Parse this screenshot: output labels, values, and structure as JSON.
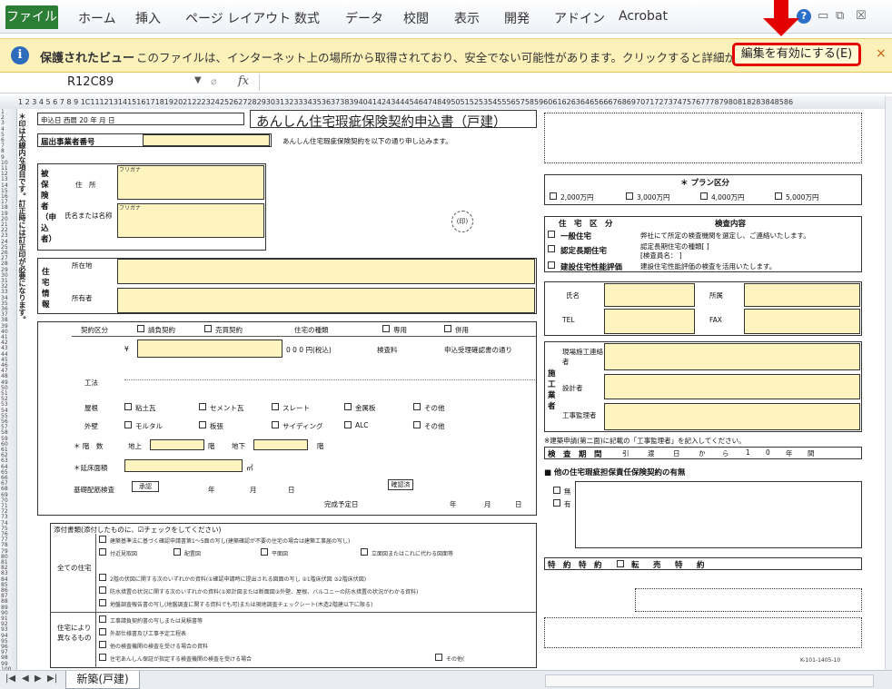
{
  "ribbon": {
    "file": "ファイル",
    "tabs": [
      "ホーム",
      "挿入",
      "ページ レイアウト",
      "数式",
      "データ",
      "校閲",
      "表示",
      "開発",
      "アドイン",
      "Acrobat"
    ]
  },
  "protected_view": {
    "title": "保護されたビュー",
    "message": "このファイルは、インターネット上の場所から取得されており、安全でない可能性があります。クリックすると詳細が表示されます。",
    "enable_button": "編集を有効にする(E)",
    "close": "×"
  },
  "formula_bar": {
    "name_box": "R12C89",
    "fx": "fx",
    "value": ""
  },
  "columns_text": "1 2 3 4 5 6 7 8 9 1C11121314151617181920212223242526272829303132333435363738394041424344454647484950515253545556575859606162636465666768697071727374757677787980818283848586",
  "form": {
    "title": "あんしん住宅瑕疵保険契約申込書（戸建）",
    "apply_date": "申込日 西暦  20    年    月    日",
    "left_side": "＊印は太線内な項目です。訂正時には訂正印が必要になります。",
    "office_no": "届出事業者番号",
    "agree": "あんしん住宅瑕疵保険契約を以下の通り申し込みます。",
    "applicant": "被保険者（申込者）",
    "furigana": "フリガナ",
    "address": "住　所",
    "name_label": "氏名または名称",
    "seal": "(印)",
    "house_info": "住宅情報",
    "location": "所在地",
    "owner": "所有者",
    "plan_title": "＊ プラン区分",
    "plans": [
      "2,000万円",
      "3,000万円",
      "4,000万円",
      "5,000万円"
    ],
    "house_type_title": "住　宅　区　分",
    "inspection": "検査内容",
    "house_types": [
      "一般住宅",
      "認定長期住宅",
      "建設住宅性能評価"
    ],
    "inspect_msgs": [
      "弊社にて所定の検査機関を選定し、ご連絡いたします。",
      "認定長期住宅の種類[                    ]",
      "[検査員名：                          ]",
      "建設住宅性能評価の検査を活用いたします。"
    ],
    "contact": [
      "氏名",
      "所属",
      "TEL",
      "FAX"
    ],
    "builder": "施工業者",
    "builder_rows": [
      "現場施工連絡者",
      "設計者",
      "工事監理者"
    ],
    "contract": "契約区分",
    "contract_opts": [
      "請負契約",
      "売買契約"
    ],
    "house_kind": "住宅の種類",
    "house_kind_opts": [
      "専用",
      "併用"
    ],
    "amount": "¥",
    "amount_unit": "0   0   0  円(税込)",
    "premium": "検査料",
    "premium_note": "申込受理確認書の通り",
    "structure": "構造",
    "construction": "工法",
    "wall": "外壁",
    "roof": "屋根",
    "wall_opts": [
      "モルタル",
      "板張",
      "サイディング",
      "ALC",
      "その他"
    ],
    "roof_opts": [
      "粘土瓦",
      "セメント瓦",
      "スレート",
      "金属板",
      "その他"
    ],
    "floors": "＊ 階　数",
    "above": "地上",
    "below": "地下",
    "floor_unit": "階",
    "area": "＊延床面積",
    "area_unit": "㎡",
    "start_date": "基礎配筋検査",
    "year": "年",
    "month": "月",
    "day": "日",
    "complete": "完成予定日",
    "approval": "承認",
    "approval2": "確認済",
    "permit_note": "※建築申請(第二面)に記載の「工事監理者」を記入してください。",
    "delivery": "検　査　期　間",
    "delivery_vals": [
      "引",
      "渡",
      "日",
      "か",
      "ら",
      "1",
      "0",
      "年",
      "間"
    ],
    "other_title": "■ 他の住宅瑕疵担保責任保険契約の有無",
    "yes": "有",
    "no": "無",
    "special": "特　約　特　約",
    "special_opts": [
      "転",
      "売",
      "特",
      "約"
    ],
    "docs_title": "添付書類(添付したものに、☑チェックをしてください)",
    "all_houses": "全ての住宅",
    "by_house": "住宅により異なるもの",
    "docs_all": [
      "建築基準法に基づく確認申請書第1〜5面の写し(建築確認が不要の住宅の場合は建築工事届の写し)",
      "付近見取図",
      "配置図",
      "平面図",
      "立面図またはこれに代わる図面等",
      "2階の伏図に関する次のいずれかの資料(①確認申請時に提出される図面の写し ②1階床伏図 ③2階床伏図)",
      "防水措置の状況に関する次のいずれかの資料(①矩計図または断面図②外壁、屋根、バルコニーの防水措置の状況がわかる資料)",
      "地盤調査報告書の写し(地盤調査に関する資料でも可)または現地調査チェックシート(木造2階建以下に限る)"
    ],
    "docs_by": [
      "工事請負契約書の写しまたは見積書等",
      "外部仕様書及び工事予定工程表",
      "他の検査機関の検査を受ける場合の資料",
      "住宅あんしん保証が指定する検査機関の検査を受ける場合"
    ],
    "other": "その他(",
    "footer_code": "K-101-1405-10"
  },
  "sheet_tab": "新築(戸建)",
  "colors": {
    "file_tab": "#2c7d35",
    "warning_bar": "#fbf1b9",
    "highlight_border": "#e20000",
    "input_cell": "#fdf4c0"
  }
}
